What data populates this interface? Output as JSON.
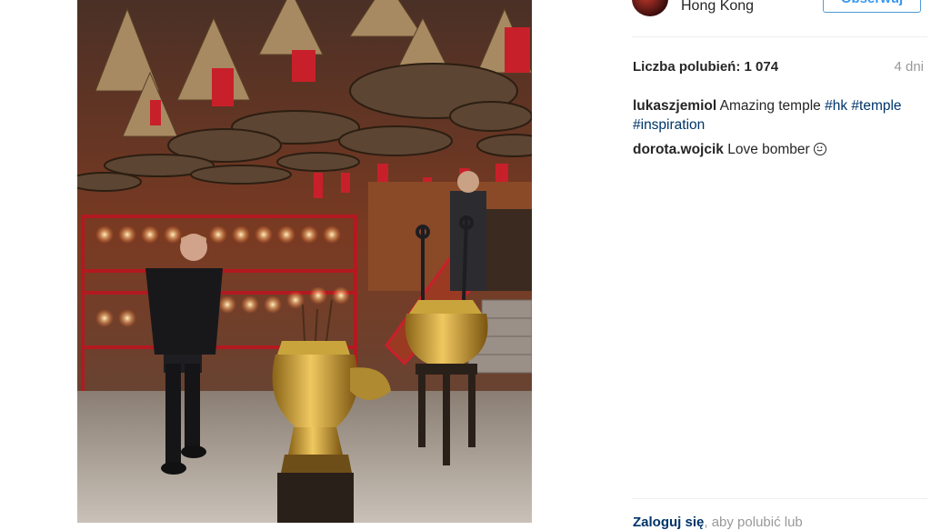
{
  "post": {
    "location": "Hong Kong",
    "follow_label": "Obserwuj",
    "likes_label": "Liczba polubień: 1 074",
    "time_ago": "4 dni",
    "caption": {
      "user": "lukaszjemiol",
      "text": "Amazing temple",
      "tags": [
        "#hk",
        "#temple",
        "#inspiration"
      ]
    },
    "comments": [
      {
        "user": "dorota.wojcik",
        "text": "Love bomber",
        "emoji": "smiling-face-icon"
      }
    ],
    "login_prompt": {
      "link": "Zaloguj się",
      "text": ", aby polubić lub"
    }
  },
  "colors": {
    "accent": "#3897f0",
    "hashtag": "#003569",
    "muted": "#999999",
    "text": "#262626"
  }
}
